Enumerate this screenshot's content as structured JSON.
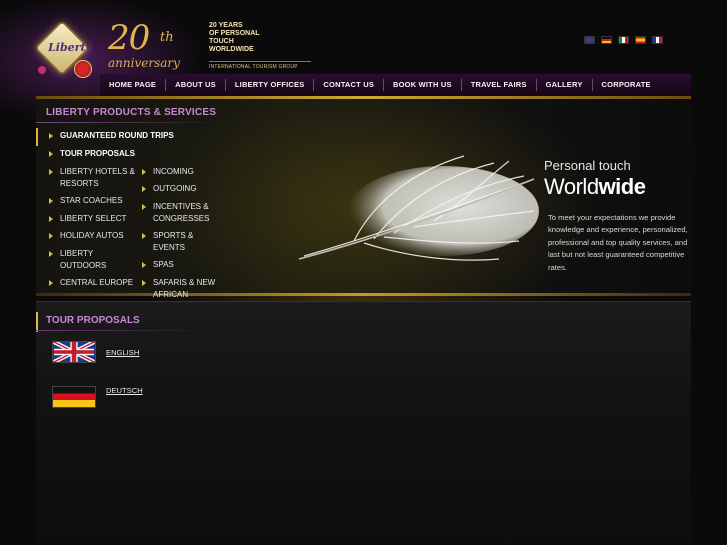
{
  "header": {
    "logo_text": "Liberty",
    "anniversary_number": "20",
    "anniversary_suffix": "th",
    "anniversary_word": "anniversary",
    "tagline_lines": [
      "20 YEARS",
      "OF PERSONAL",
      "TOUCH",
      "WORLDWIDE"
    ],
    "group_line": "INTERNATIONAL TOURISM GROUP",
    "language_flags": [
      "uk-flag-icon",
      "germany-flag-icon",
      "italy-flag-icon",
      "spain-flag-icon",
      "france-flag-icon"
    ]
  },
  "nav": {
    "items": [
      "HOME PAGE",
      "ABOUT US",
      "LIBERTY OFFICES",
      "CONTACT US",
      "BOOK WITH US",
      "TRAVEL FAIRS",
      "GALLERY",
      "CORPORATE"
    ]
  },
  "sidebar": {
    "title": "LIBERTY PRODUCTS & SERVICES",
    "top_items": [
      "GUARANTEED ROUND TRIPS",
      "TOUR PROPOSALS"
    ],
    "col1": [
      "LIBERTY HOTELS & RESORTS",
      "STAR COACHES",
      "LIBERTY SELECT",
      "HOLIDAY AUTOS",
      "LIBERTY OUTDOORS",
      "CENTRAL EUROPE"
    ],
    "col2": [
      "INCOMING",
      "OUTGOING",
      "INCENTIVES & CONGRESSES",
      "SPORTS & EVENTS",
      "SPAS",
      "SAFARIS & NEW AFRICAN TERRITORIES"
    ]
  },
  "hero": {
    "line1": "Personal touch",
    "line2a": "World",
    "line2b": "wide",
    "text": "To meet your expectations we provide knowledge and experience, personalized, professional and top quality services, and last but not least guaranteed competitive rates."
  },
  "tour_proposals": {
    "title": "TOUR PROPOSALS",
    "languages": [
      "ENGLISH",
      "DEUTSCH"
    ]
  },
  "colors": {
    "accent_purple": "#c789d6",
    "accent_gold": "#d8b640",
    "nav_bg": "#2a0d30"
  }
}
